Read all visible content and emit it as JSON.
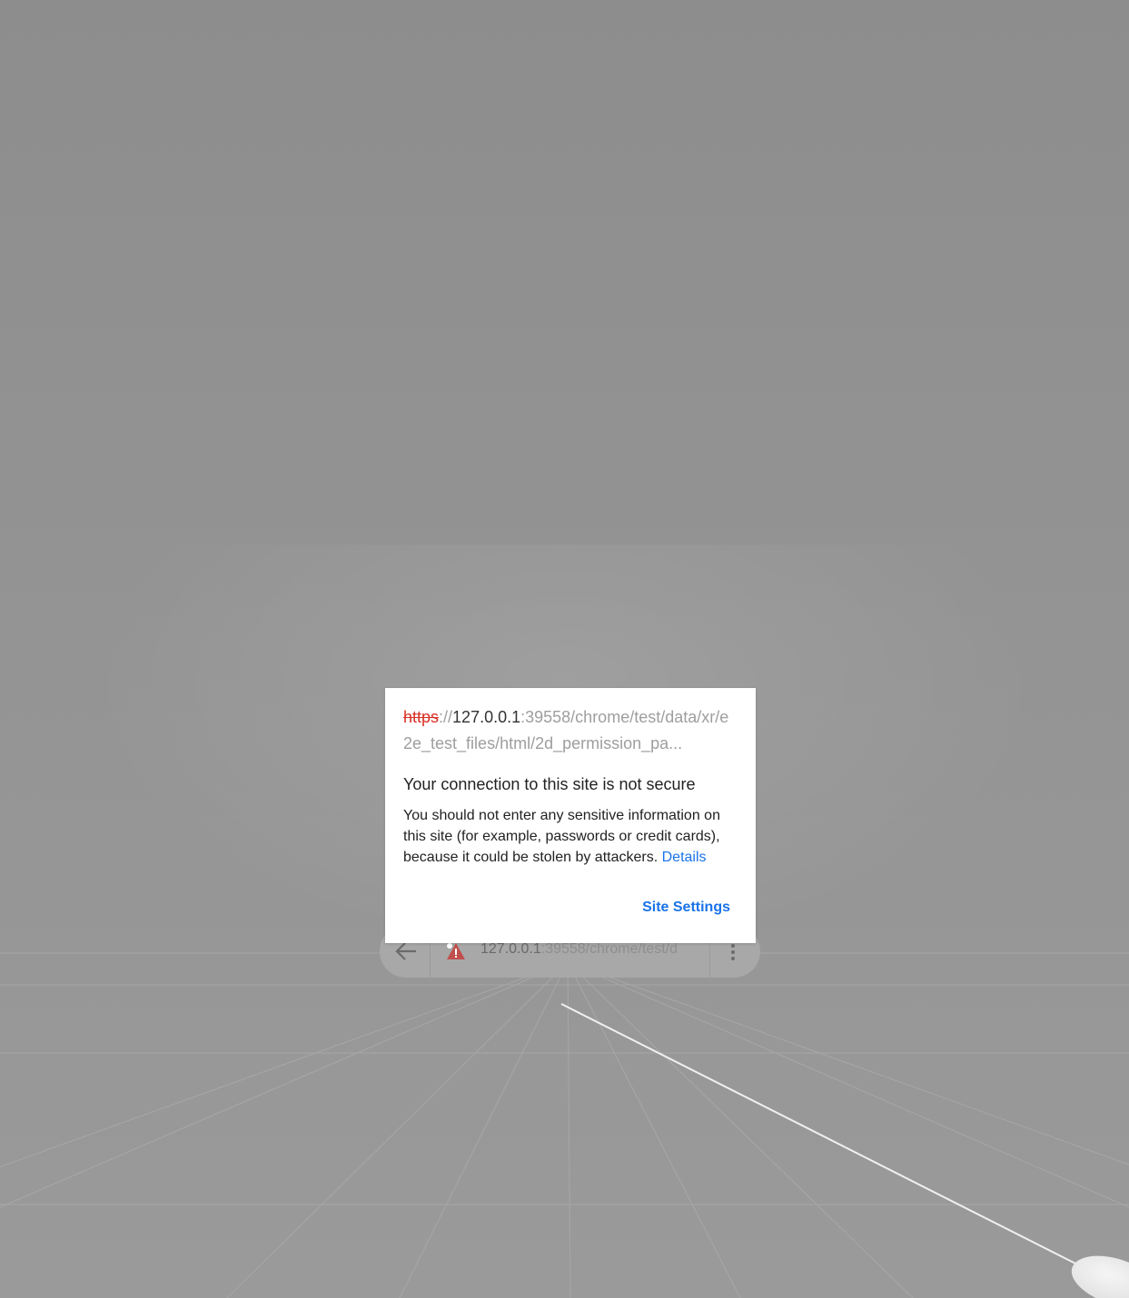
{
  "urlbar": {
    "url_host": "127.0.0.1",
    "url_rest": ":39558/chrome/test/d",
    "icons": {
      "back": "back-arrow-icon",
      "security": "warning-icon",
      "menu": "more-vert-icon"
    }
  },
  "dialog": {
    "url_scheme": "https",
    "url_separator": "://",
    "url_host": "127.0.0.1",
    "url_path": ":39558/chrome/test/data/xr/e2e_test_files/html/2d_permission_pa...",
    "title": "Your connection to this site is not secure",
    "body": "You should not enter any sensitive information on this site (for example, passwords or credit cards), because it could be stolen by attackers. ",
    "details_link": "Details",
    "site_settings_button": "Site Settings"
  },
  "colors": {
    "scheme_red": "#d93025",
    "link_blue": "#1a73e8",
    "background_gray": "#8f8f8f"
  }
}
